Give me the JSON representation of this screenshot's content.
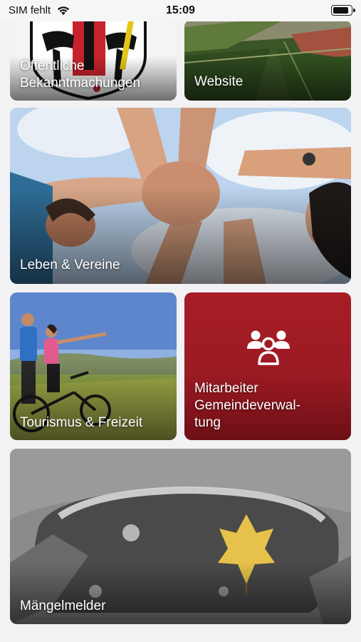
{
  "status_bar": {
    "carrier": "SIM fehlt",
    "time": "15:09"
  },
  "tiles": [
    {
      "label": "Öffentliche\nBekanntmachungen",
      "image": "coat-of-arms-image"
    },
    {
      "label": "Website",
      "image": "aerial-fields-image"
    },
    {
      "label": "Leben & Vereine",
      "image": "joined-hands-image"
    },
    {
      "label": "Tourismus & Freizeit",
      "image": "cyclists-image"
    },
    {
      "label": "Mitarbeiter\nGemeindeverwal-\ntung",
      "icon": "team-icon",
      "bg": "#a81d26"
    },
    {
      "label": "Mängelmelder",
      "image": "pothole-leaf-image"
    }
  ]
}
